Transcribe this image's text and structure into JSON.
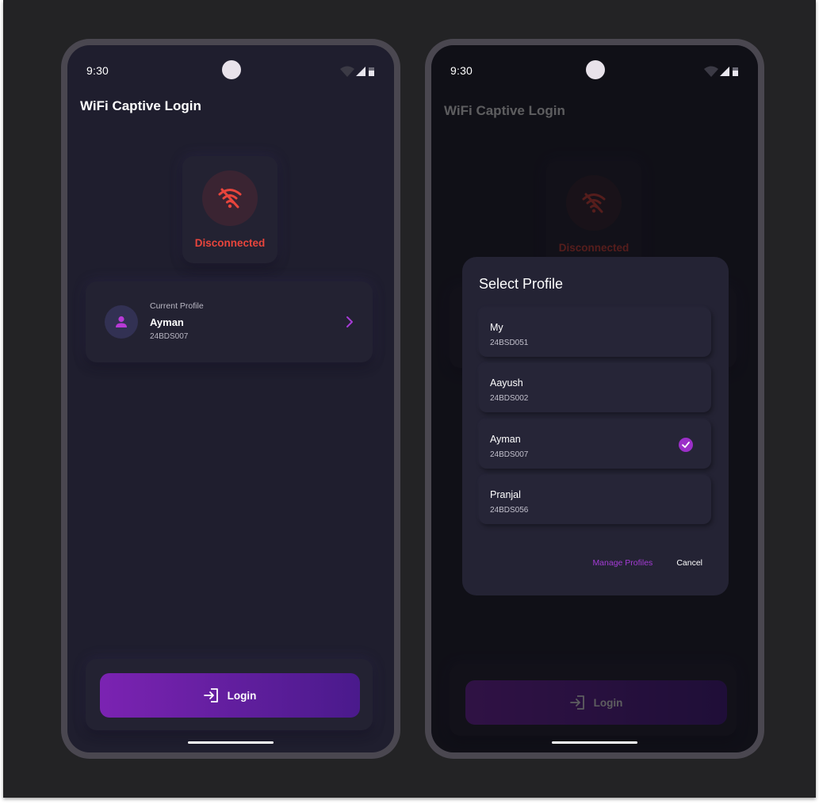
{
  "status_bar": {
    "time": "9:30"
  },
  "app": {
    "title": "WiFi Captive Login"
  },
  "connection": {
    "status": "Disconnected",
    "status_color": "#e8453c"
  },
  "current_profile": {
    "caption": "Current Profile",
    "name": "Ayman",
    "id": "24BDS007"
  },
  "login": {
    "label": "Login"
  },
  "dialog": {
    "title": "Select Profile",
    "profiles": [
      {
        "name": "My",
        "id": "24BSD051",
        "selected": false
      },
      {
        "name": "Aayush",
        "id": "24BDS002",
        "selected": false
      },
      {
        "name": "Ayman",
        "id": "24BDS007",
        "selected": true
      },
      {
        "name": "Pranjal",
        "id": "24BDS056",
        "selected": false
      }
    ],
    "manage_label": "Manage Profiles",
    "cancel_label": "Cancel"
  },
  "colors": {
    "accent": "#9b2fc8",
    "background": "#1f1e2e",
    "card": "#232232"
  }
}
